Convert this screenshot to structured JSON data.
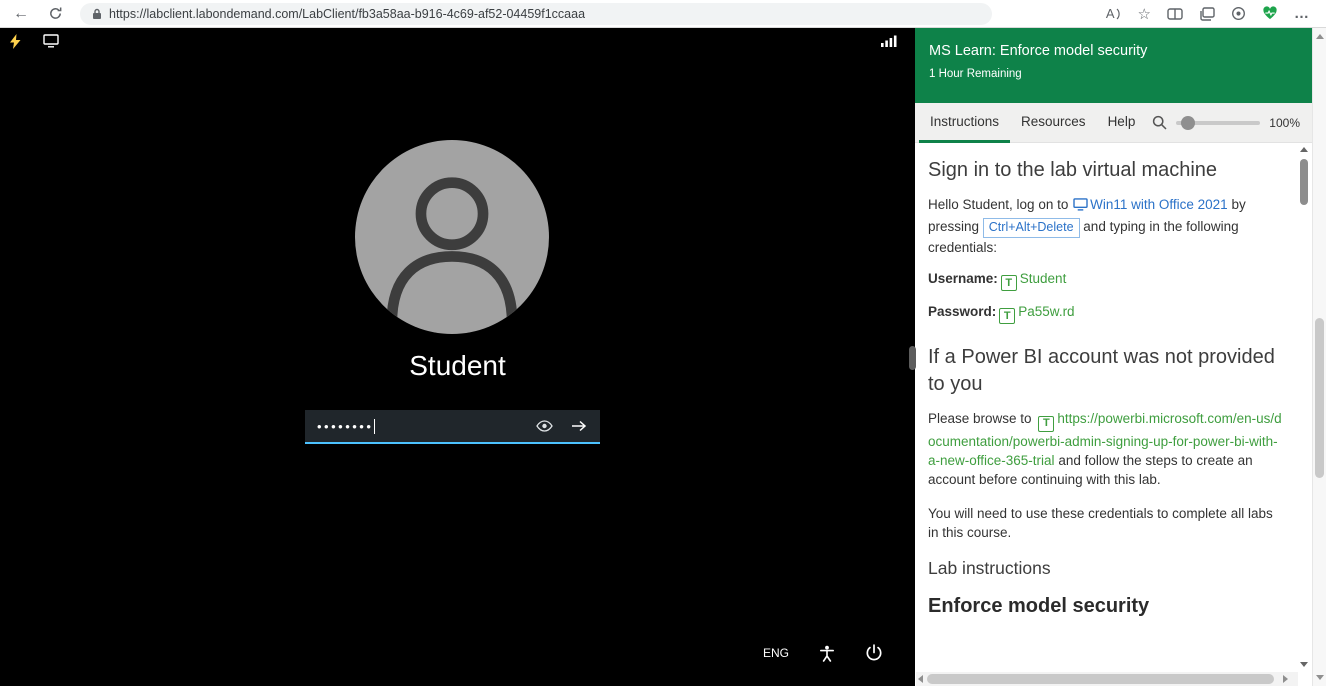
{
  "browser": {
    "url": "https://labclient.labondemand.com/LabClient/fb3a58aa-b916-4c69-af52-04459f1ccaaa",
    "icons": {
      "back": "←",
      "read_aloud": "A",
      "favorites": "☆",
      "more": "…"
    }
  },
  "vm": {
    "login": {
      "username": "Student",
      "password_masked": "••••••••",
      "language_badge": "ENG"
    }
  },
  "panel": {
    "header": {
      "title": "MS Learn: Enforce model security",
      "time_remaining": "1 Hour Remaining"
    },
    "tabs": {
      "instructions": "Instructions",
      "resources": "Resources",
      "help": "Help",
      "zoom_level": "100%"
    },
    "content": {
      "signin_heading": "Sign in to the lab virtual machine",
      "p1_before": "Hello Student, log on to ",
      "vm_link_label": "Win11 with Office 2021",
      "p1_mid": " by pressing ",
      "kbd_label": "Ctrl+Alt+Delete",
      "p1_after": " and typing in the following credentials:",
      "type_text_glyph": "T",
      "username_label": "Username:",
      "username_value": "Student",
      "password_label": "Password:",
      "password_value": "Pa55w.rd",
      "powerbi_heading": "If a Power BI account was not provided to you",
      "p2_before": "Please browse to ",
      "powerbi_link_label": "https://powerbi.microsoft.com/en-us/documentation/powerbi-admin-signing-up-for-power-bi-with-a-new-office-365-trial",
      "p2_after": " and follow the steps to create an account before continuing with this lab.",
      "p3": "You will need to use these credentials to complete all labs in this course.",
      "lab_instructions_heading": "Lab instructions",
      "lab_title": "Enforce model security"
    },
    "colors": {
      "header_green": "#0e8249",
      "link_green": "#3f9e3f",
      "link_blue": "#2b72c8",
      "vm_accent_blue": "#4cc2ff"
    }
  }
}
